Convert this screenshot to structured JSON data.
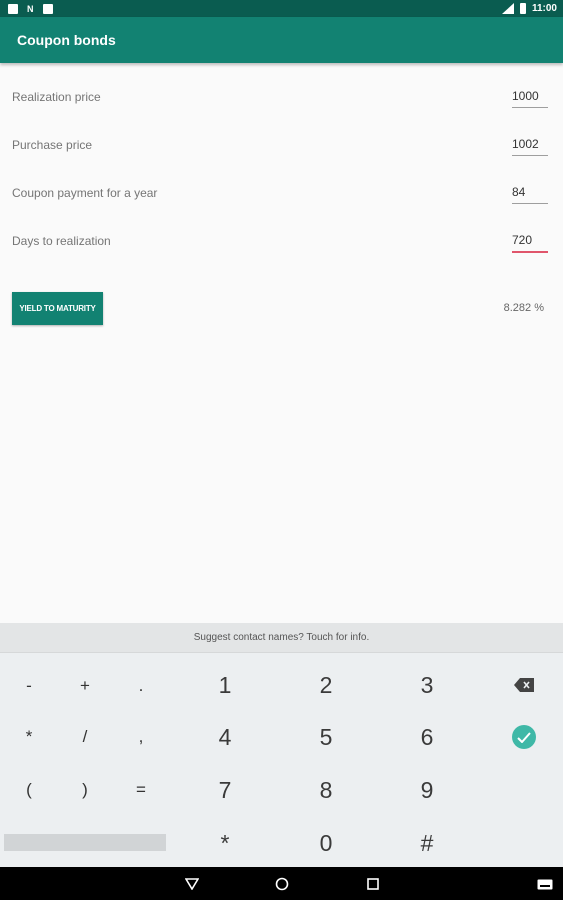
{
  "status_bar": {
    "time": "11:00",
    "left_icons": [
      "sd-card-icon",
      "notification-n-icon",
      "notification-icon"
    ],
    "right_icons": [
      "signal-icon",
      "battery-icon"
    ]
  },
  "app_bar": {
    "title": "Coupon bonds",
    "color": "#128272"
  },
  "form": {
    "fields": [
      {
        "label": "Realization price",
        "value": "1000"
      },
      {
        "label": "Purchase price",
        "value": "1002"
      },
      {
        "label": "Coupon payment for a year",
        "value": "84"
      },
      {
        "label": "Days to realization",
        "value": "720"
      }
    ]
  },
  "yield": {
    "button_label": "YIELD TO MATURITY",
    "result": "8.282 %"
  },
  "keyboard": {
    "suggestion": "Suggest contact names? Touch for info.",
    "row1": [
      "-",
      "+",
      ".",
      "1",
      "2",
      "3"
    ],
    "row2": [
      "*",
      "/",
      ",",
      "4",
      "5",
      "6"
    ],
    "row3": [
      "(",
      ")",
      "=",
      "7",
      "8",
      "9"
    ],
    "row4": [
      "*",
      "0",
      "#"
    ],
    "accent": "#3fb8a7"
  },
  "nav_bar": {
    "buttons": [
      "back-icon",
      "home-icon",
      "recents-icon",
      "keyboard-switch-icon"
    ]
  }
}
